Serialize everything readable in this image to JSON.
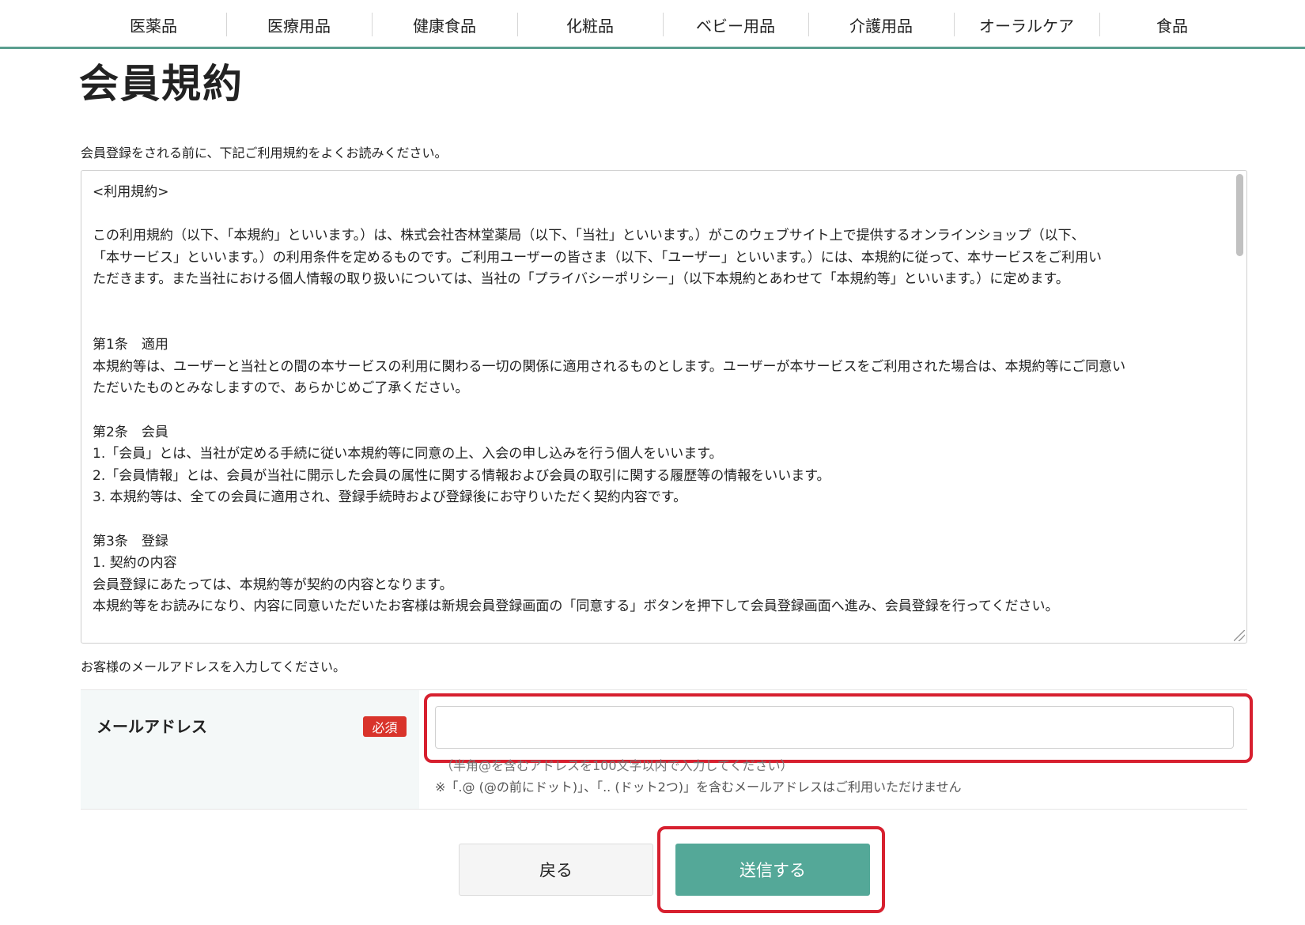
{
  "nav": {
    "items": [
      {
        "label": "医薬品"
      },
      {
        "label": "医療用品"
      },
      {
        "label": "健康食品"
      },
      {
        "label": "化粧品"
      },
      {
        "label": "ベビー用品"
      },
      {
        "label": "介護用品"
      },
      {
        "label": "オーラルケア"
      },
      {
        "label": "食品"
      }
    ]
  },
  "page": {
    "title": "会員規約",
    "intro": "会員登録をされる前に、下記ご利用規約をよくお読みください。"
  },
  "terms": {
    "text": "<利用規約>\n\nこの利用規約（以下、「本規約」といいます。）は、株式会社杏林堂薬局（以下、「当社」といいます。）がこのウェブサイト上で提供するオンラインショップ（以下、\n「本サービス」といいます。）の利用条件を定めるものです。ご利用ユーザーの皆さま（以下、「ユーザー」といいます。）には、本規約に従って、本サービスをご利用い\nただきます。また当社における個人情報の取り扱いについては、当社の「プライバシーポリシー」（以下本規約とあわせて「本規約等」といいます。）に定めます。\n\n\n第1条　適用\n本規約等は、ユーザーと当社との間の本サービスの利用に関わる一切の関係に適用されるものとします。ユーザーが本サービスをご利用された場合は、本規約等にご同意い\nただいたものとみなしますので、あらかじめご了承ください。\n\n第2条　会員\n1.「会員」とは、当社が定める手続に従い本規約等に同意の上、入会の申し込みを行う個人をいいます。\n2.「会員情報」とは、会員が当社に開示した会員の属性に関する情報および会員の取引に関する履歴等の情報をいいます。\n3. 本規約等は、全ての会員に適用され、登録手続時および登録後にお守りいただく契約内容です。\n\n第3条　登録\n1. 契約の内容\n会員登録にあたっては、本規約等が契約の内容となります。\n本規約等をお読みになり、内容に同意いただいたお客様は新規会員登録画面の「同意する」ボタンを押下して会員登録画面へ進み、会員登録を行ってください。"
  },
  "form": {
    "instruction": "お客様のメールアドレスを入力してください。",
    "email_label": "メールアドレス",
    "required_badge": "必須",
    "email_value": "",
    "hint_length": "（半角@を含むアドレスを100文字以内で入力してください）",
    "hint_dots": "※「.@ (@の前にドット)」、「.. (ドット2つ)」を含むメールアドレスはご利用いただけません"
  },
  "buttons": {
    "back": "戻る",
    "submit": "送信する"
  },
  "colors": {
    "accent": "#54a898",
    "nav_underline": "#5a9e8f",
    "required": "#d9342b",
    "highlight": "#d7202f"
  }
}
